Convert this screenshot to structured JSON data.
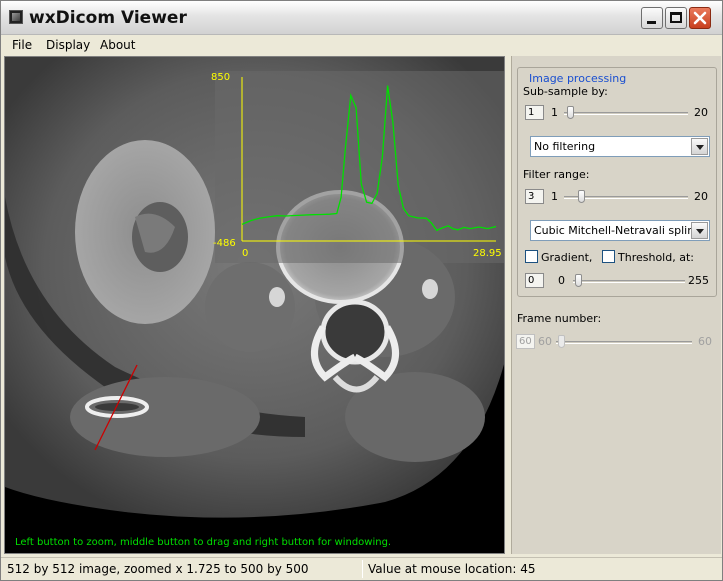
{
  "window": {
    "title": "wxDicom Viewer"
  },
  "menu": {
    "items": [
      "File",
      "Display",
      "About"
    ]
  },
  "viewer": {
    "overlay_plot": {
      "y_max_label": "850",
      "y_min_label": "-486",
      "x_min_label": "0",
      "x_max_label": "28.95",
      "axis_color": "#ffff00",
      "curve_color": "#00e000",
      "profile_points": [
        [
          0,
          -350
        ],
        [
          1,
          -320
        ],
        [
          2,
          -300
        ],
        [
          3,
          -290
        ],
        [
          4,
          -280
        ],
        [
          5,
          -282
        ],
        [
          6,
          -278
        ],
        [
          7,
          -275
        ],
        [
          8,
          -272
        ],
        [
          9,
          -270
        ],
        [
          10,
          -268
        ],
        [
          10.8,
          -262
        ],
        [
          11.3,
          -130
        ],
        [
          11.8,
          280
        ],
        [
          12.4,
          700
        ],
        [
          13,
          600
        ],
        [
          13.6,
          -20
        ],
        [
          14.2,
          -170
        ],
        [
          14.8,
          -180
        ],
        [
          15.4,
          -100
        ],
        [
          16,
          200
        ],
        [
          16.6,
          780
        ],
        [
          17.2,
          480
        ],
        [
          17.8,
          -30
        ],
        [
          18.4,
          -220
        ],
        [
          19,
          -280
        ],
        [
          20,
          -298
        ],
        [
          21,
          -300
        ],
        [
          21.6,
          -340
        ],
        [
          22.2,
          -400
        ],
        [
          22.8,
          -380
        ],
        [
          23.5,
          -362
        ],
        [
          24,
          -385
        ],
        [
          24.6,
          -395
        ],
        [
          25.3,
          -375
        ],
        [
          26,
          -385
        ],
        [
          27,
          -372
        ],
        [
          28,
          -385
        ],
        [
          28.95,
          -368
        ]
      ]
    },
    "measure_line_color": "#cc0000",
    "hint_text": "Left button to zoom, middle button to drag and right button for windowing."
  },
  "panel": {
    "group_title": "Image processing",
    "subsample": {
      "label": "Sub-sample by:",
      "value": "1",
      "min": "1",
      "max": "20",
      "level": 0.0
    },
    "filter_select": {
      "value": "No filtering"
    },
    "filter_range": {
      "label": "Filter range:",
      "value": "3",
      "min": "1",
      "max": "20",
      "level": 0.105
    },
    "interp_select": {
      "value": "Cubic Mitchell-Netravali spline"
    },
    "gradient": {
      "label": "Gradient,",
      "checked": false
    },
    "threshold": {
      "label": "Threshold, at:",
      "checked": false,
      "value": "0",
      "min": "0",
      "max": "255",
      "level": 0.0
    },
    "frame": {
      "label": "Frame number:",
      "value": "60",
      "min": "60",
      "max": "60",
      "level": 0.0
    }
  },
  "status": {
    "left": "512 by 512 image, zoomed x 1.725 to 500 by 500",
    "right": "Value at mouse location: 45"
  }
}
